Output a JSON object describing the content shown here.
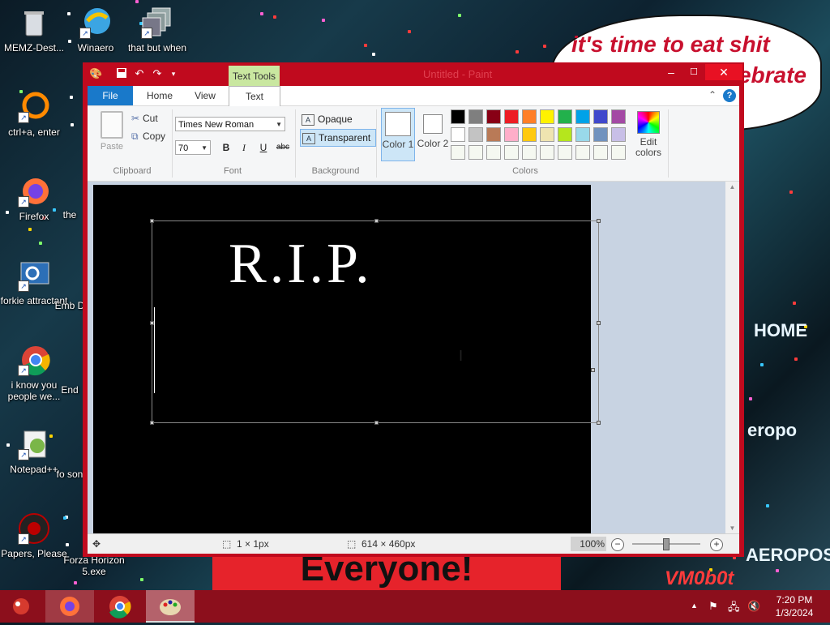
{
  "wallpaper": {
    "speech_line1": "it's time to eat shit",
    "speech_line2": "ebrate",
    "banner": "Everyone!",
    "sign1": "HOME",
    "sign2": "eropo",
    "sign3": "AEROPOS",
    "sign4": "VM0b0t"
  },
  "desktop_icons": [
    {
      "label": "MEMZ-Dest..."
    },
    {
      "label": "Winaero"
    },
    {
      "label": "that but when"
    },
    {
      "label": "ctrl+a, enter"
    },
    {
      "label": "Firefox"
    },
    {
      "label": "the"
    },
    {
      "label": "forkie attractant"
    },
    {
      "label": "Emb D"
    },
    {
      "label": "i know you people we..."
    },
    {
      "label": "End"
    },
    {
      "label": "Notepad++"
    },
    {
      "label": "fo son"
    },
    {
      "label": "Papers, Please"
    },
    {
      "label": "Forza Horizon 5.exe"
    }
  ],
  "window": {
    "title": "Untitled - Paint",
    "text_tools_label": "Text Tools",
    "tabs": {
      "file": "File",
      "home": "Home",
      "view": "View",
      "text": "Text"
    },
    "clipboard": {
      "paste": "Paste",
      "cut": "Cut",
      "copy": "Copy",
      "label": "Clipboard"
    },
    "font": {
      "family": "Times New Roman",
      "size": "70",
      "label": "Font",
      "bold": "B",
      "italic": "I",
      "underline": "U",
      "strike": "abc"
    },
    "background": {
      "opaque": "Opaque",
      "transparent": "Transparent",
      "label": "Background"
    },
    "colors": {
      "color1_label": "Color 1",
      "color2_label": "Color 2",
      "edit_label": "Edit colors",
      "label": "Colors",
      "color1": "#ffffff",
      "color2": "#ffffff",
      "palette_row1": [
        "#000000",
        "#7f7f7f",
        "#880015",
        "#ed1c24",
        "#ff7f27",
        "#fff200",
        "#22b14c",
        "#00a2e8",
        "#3f48cc",
        "#a349a4"
      ],
      "palette_row2": [
        "#ffffff",
        "#c3c3c3",
        "#b97a57",
        "#ffaec9",
        "#ffc90e",
        "#efe4b0",
        "#b5e61d",
        "#99d9ea",
        "#7092be",
        "#c8bfe7"
      ],
      "palette_row3": [
        "#f5f8f1",
        "#f5f8f1",
        "#f5f8f1",
        "#f5f8f1",
        "#f5f8f1",
        "#f5f8f1",
        "#f5f8f1",
        "#f5f8f1",
        "#f5f8f1",
        "#f5f8f1"
      ]
    },
    "canvas_text": "R.I.P.",
    "status": {
      "selection": "1 × 1px",
      "image_size": "614 × 460px",
      "zoom": "100%"
    }
  },
  "taskbar": {
    "clock_time": "7:20 PM",
    "clock_date": "1/3/2024",
    "accent": "#8c0f1c"
  }
}
